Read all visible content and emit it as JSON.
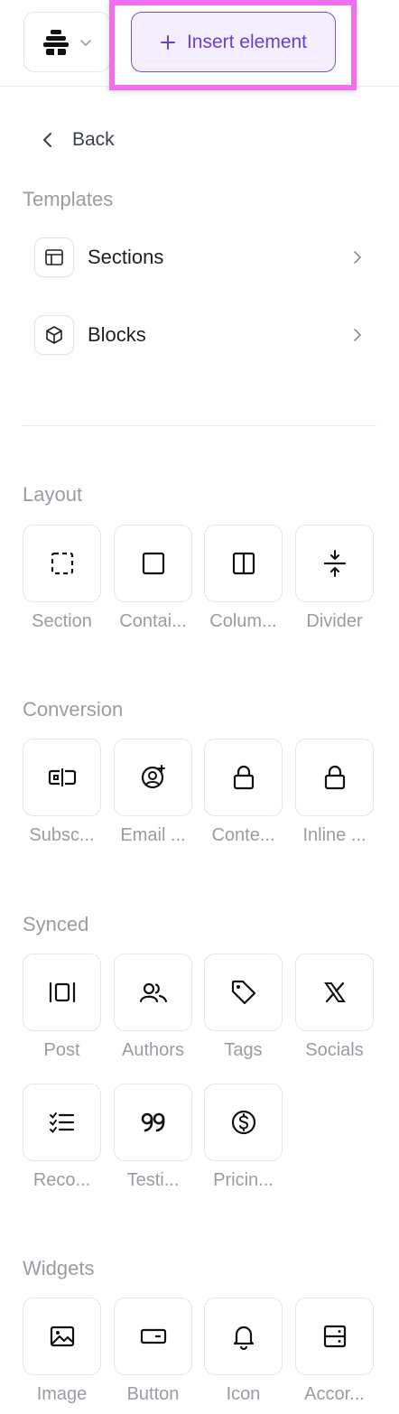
{
  "header": {
    "logo_icon": "beehiiv-logo-icon",
    "insert_label": "Insert element",
    "highlight_color": "#f06ff0",
    "accent_color": "#6a3fd0"
  },
  "nav": {
    "back_label": "Back"
  },
  "templates": {
    "title": "Templates",
    "items": [
      {
        "label": "Sections",
        "icon": "layout-icon"
      },
      {
        "label": "Blocks",
        "icon": "cube-icon"
      }
    ]
  },
  "layout": {
    "title": "Layout",
    "items": [
      {
        "label": "Section",
        "icon": "dashed-square-icon"
      },
      {
        "label": "Contai...",
        "icon": "square-icon"
      },
      {
        "label": "Colum...",
        "icon": "columns-icon"
      },
      {
        "label": "Divider",
        "icon": "divider-icon"
      }
    ]
  },
  "conversion": {
    "title": "Conversion",
    "items": [
      {
        "label": "Subsc...",
        "icon": "subscribe-input-icon"
      },
      {
        "label": "Email ...",
        "icon": "user-plus-circle-icon"
      },
      {
        "label": "Conte...",
        "icon": "lock-icon"
      },
      {
        "label": "Inline ...",
        "icon": "lock-icon"
      }
    ]
  },
  "synced": {
    "title": "Synced",
    "items": [
      {
        "label": "Post",
        "icon": "post-icon"
      },
      {
        "label": "Authors",
        "icon": "users-icon"
      },
      {
        "label": "Tags",
        "icon": "tag-icon"
      },
      {
        "label": "Socials",
        "icon": "x-logo-icon"
      },
      {
        "label": "Reco...",
        "icon": "checklist-icon"
      },
      {
        "label": "Testi...",
        "icon": "quote-icon"
      },
      {
        "label": "Pricin...",
        "icon": "dollar-circle-icon"
      }
    ]
  },
  "widgets": {
    "title": "Widgets",
    "items": [
      {
        "label": "Image",
        "icon": "image-icon"
      },
      {
        "label": "Button",
        "icon": "button-icon"
      },
      {
        "label": "Icon",
        "icon": "bell-icon"
      },
      {
        "label": "Accor...",
        "icon": "accordion-icon"
      }
    ]
  }
}
